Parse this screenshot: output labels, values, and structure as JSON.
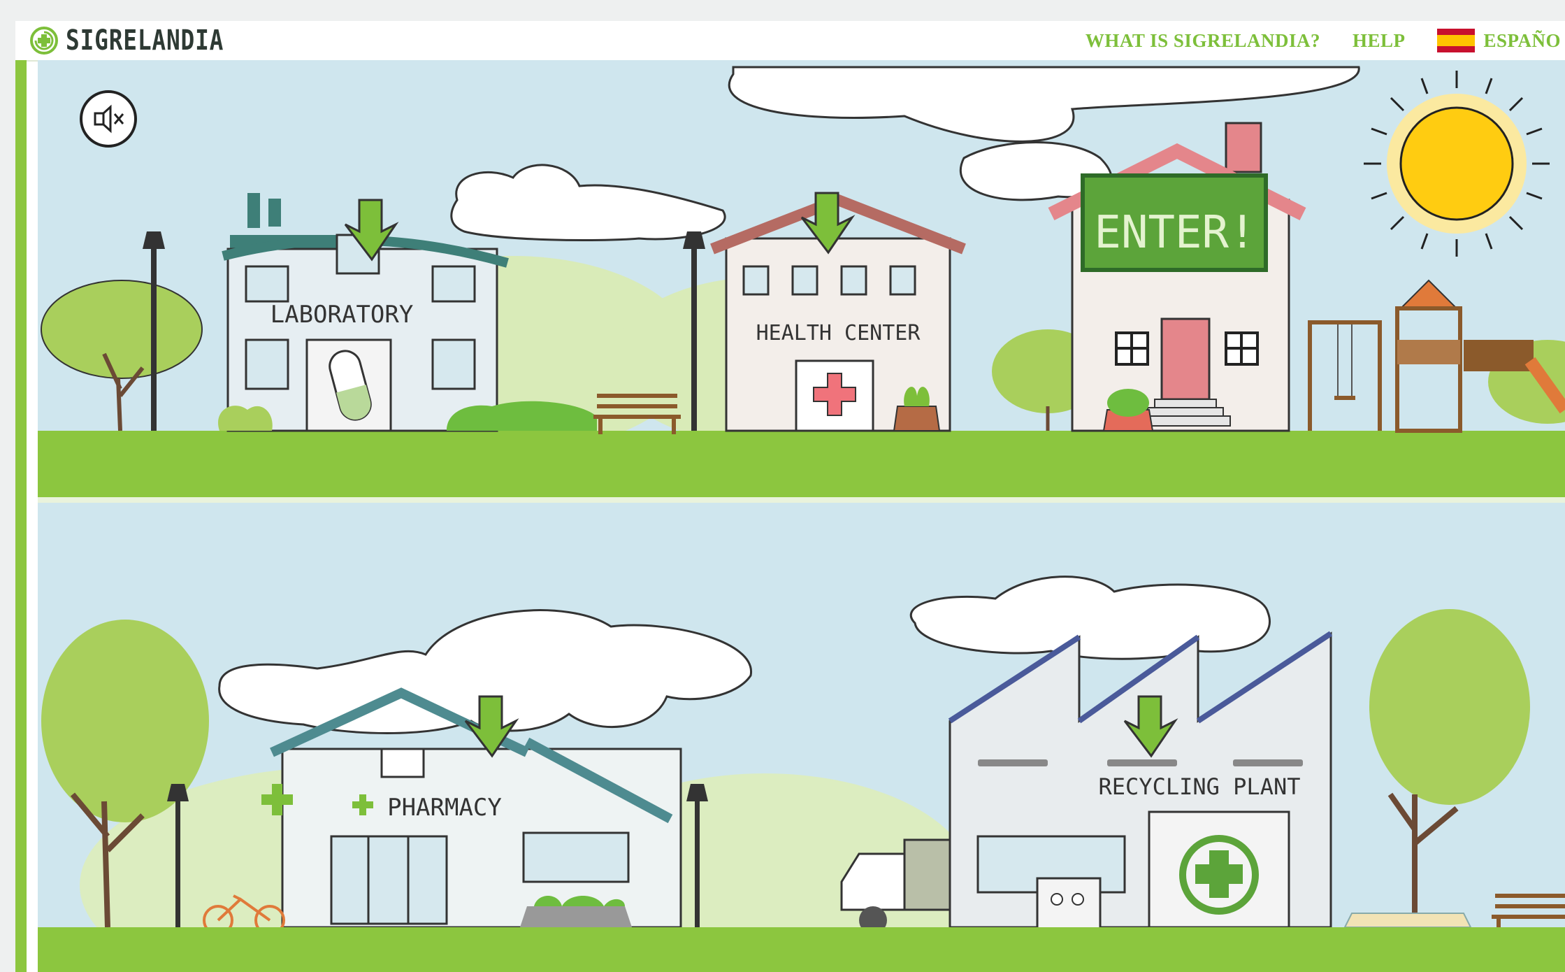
{
  "header": {
    "brand": "SIGRELANDIA",
    "nav": {
      "what_is": "WHAT IS SIGRELANDIA?",
      "help": "HELP",
      "language": "ESPAÑO"
    }
  },
  "scene": {
    "buildings": {
      "laboratory": "LABORATORY",
      "health_center": "HEALTH CENTER",
      "enter": "ENTER!",
      "pharmacy": "PHARMACY",
      "recycling_plant": "RECYCLING PLANT"
    }
  },
  "colors": {
    "brand_green": "#7dbf3a",
    "grass": "#8cc63f",
    "sky": "#cfe6ee"
  },
  "icons": [
    "logo-cross-icon",
    "mute-icon",
    "spain-flag-icon",
    "arrow-down-icon",
    "pill-icon",
    "cross-icon",
    "recycle-icon",
    "sun-icon"
  ]
}
